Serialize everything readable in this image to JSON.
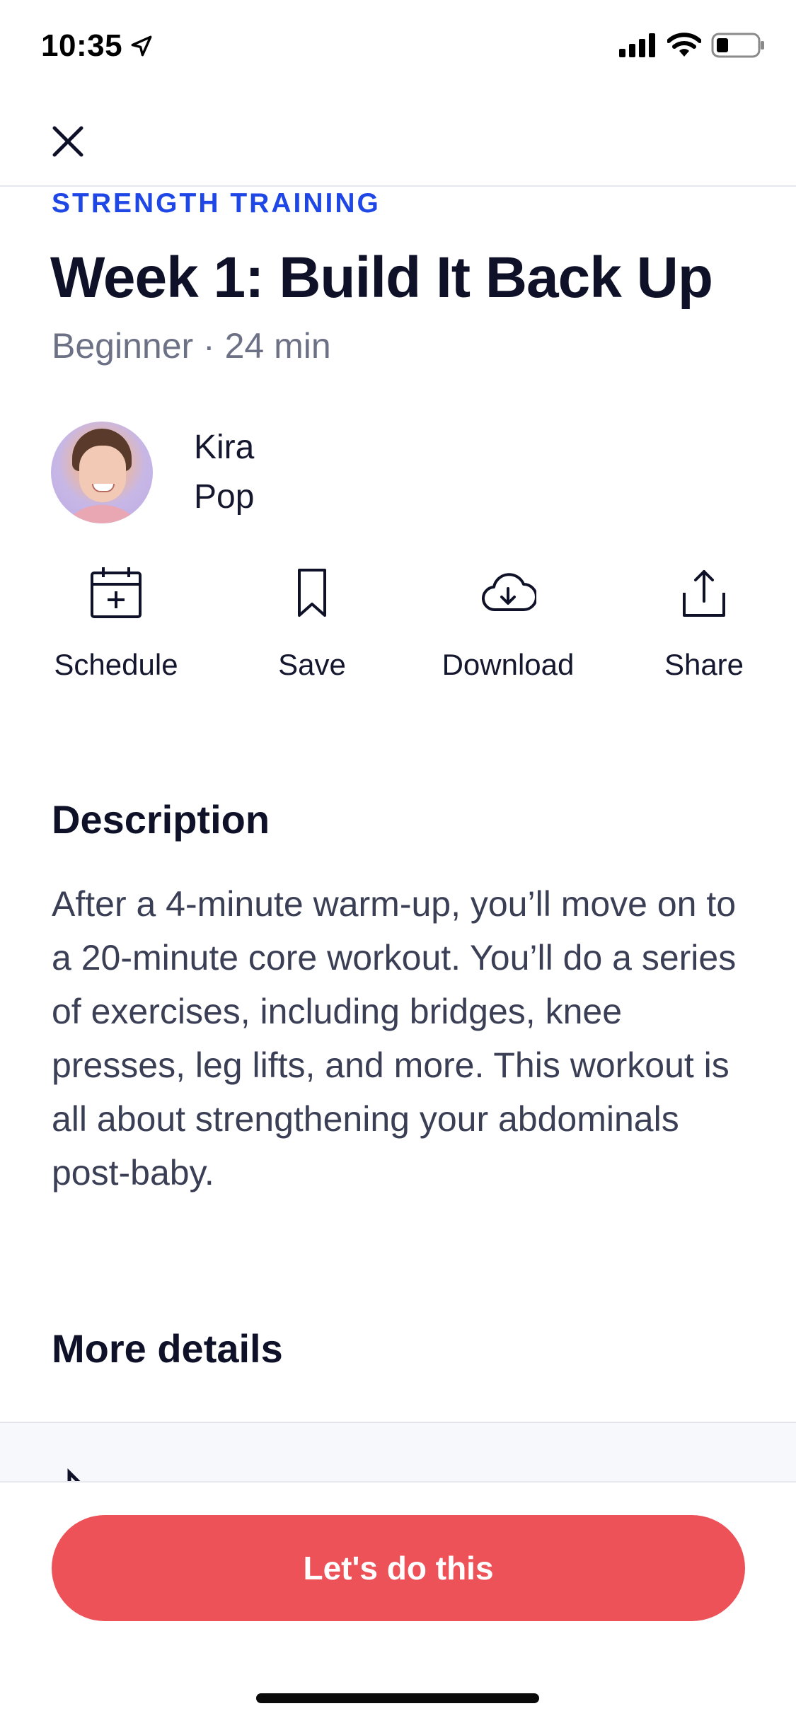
{
  "status_bar": {
    "time": "10:35"
  },
  "header": {
    "close_icon": "close-icon"
  },
  "workout": {
    "category": "STRENGTH TRAINING",
    "title": "Week 1: Build It Back Up",
    "meta": "Beginner · 24 min"
  },
  "instructor": {
    "name": "Kira",
    "genre": "Pop"
  },
  "actions": [
    {
      "label": "Schedule",
      "icon": "calendar-add-icon"
    },
    {
      "label": "Save",
      "icon": "bookmark-icon"
    },
    {
      "label": "Download",
      "icon": "cloud-download-icon"
    },
    {
      "label": "Share",
      "icon": "share-icon"
    }
  ],
  "description": {
    "heading": "Description",
    "text": "After a 4-minute warm-up, you’ll move on to a 20-minute core workout. You’ll do a series of exercises, including bridges, knee presses, leg lifts, and more. This workout is all about strengthening your abdominals post-baby."
  },
  "more_details": {
    "heading": "More details"
  },
  "cta": {
    "label": "Let's do this"
  },
  "colors": {
    "accent_blue": "#1f47e6",
    "cta_red": "#ec5258"
  }
}
